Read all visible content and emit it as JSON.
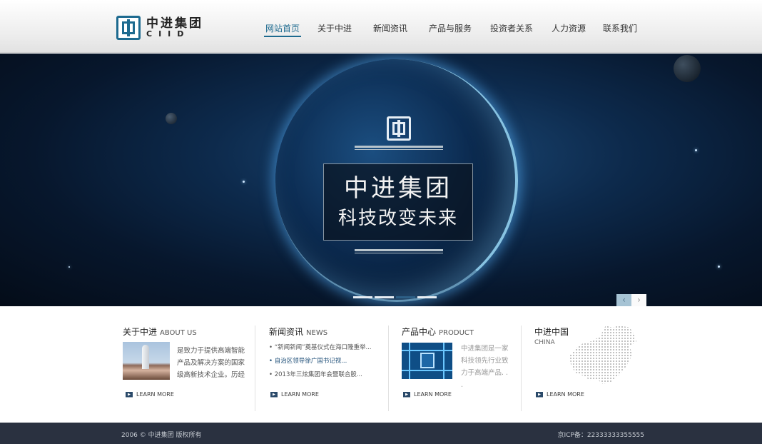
{
  "brand": {
    "name_cn": "中进集团",
    "name_en": "CIID",
    "color": "#1d6a8f"
  },
  "nav": {
    "items": [
      {
        "label": "网站首页",
        "active": true
      },
      {
        "label": "关于中进",
        "active": false
      },
      {
        "label": "新闻资讯",
        "active": false
      },
      {
        "label": "产品与服务",
        "active": false
      },
      {
        "label": "投资者关系",
        "active": false
      },
      {
        "label": "人力资源",
        "active": false
      },
      {
        "label": "联系我们",
        "active": false
      }
    ]
  },
  "banner": {
    "title": "中进集团",
    "subtitle": "科技改变未来",
    "slide_count": 4,
    "active_slide": 3,
    "prev_icon": "chevron-left-icon",
    "next_icon": "chevron-right-icon"
  },
  "about": {
    "title": "关于中进",
    "title_en": "ABOUT US",
    "text": "是致力于提供高端智能产品及解决方案的国家级高新技术企业。历经",
    "more": "LEARN MORE"
  },
  "news": {
    "title": "新闻资讯",
    "title_en": "NEWS",
    "items": [
      "• “新闻新闻”奠基仪式在海口隆重举...",
      "• 自治区领导徐广国书记视...",
      "• 2013年三炫集团年会暨联合股..."
    ],
    "more": "LEARN MORE"
  },
  "product": {
    "title": "产品中心",
    "title_en": "PRODUCT",
    "text": "中进集团是一家科技领先行业致力于高端产品. . .",
    "more": "LEARN MORE"
  },
  "china": {
    "title": "中进中国",
    "title_en": "CHINA",
    "more": "LEARN MORE"
  },
  "footer": {
    "copyright": "2006 © 中进集团 版权所有",
    "icp": "京ICP备：22333333355555"
  }
}
